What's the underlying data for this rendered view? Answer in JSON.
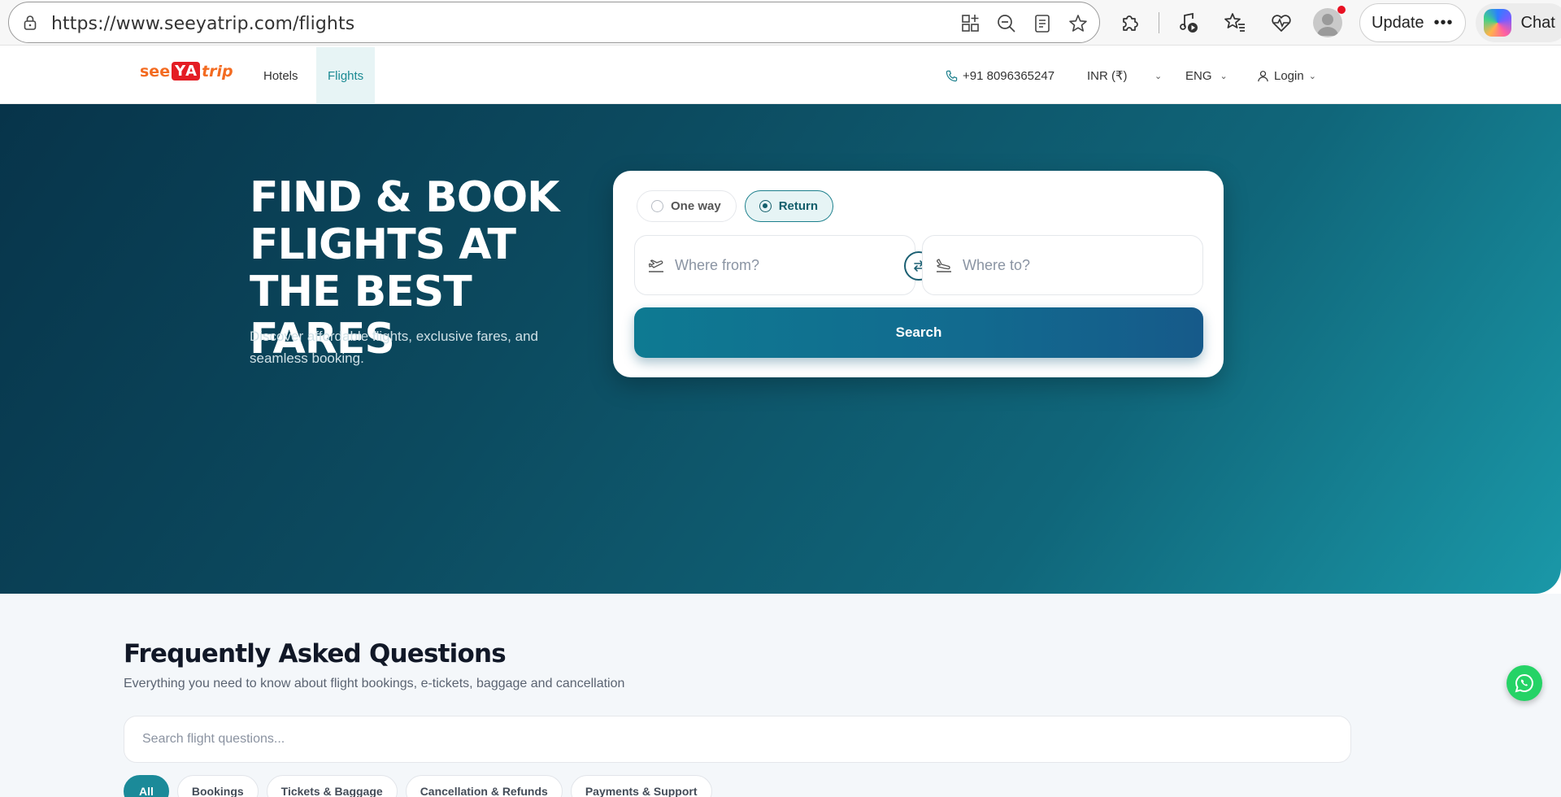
{
  "browser": {
    "url": "https://www.seeyatrip.com/flights",
    "update_label": "Update",
    "update_more": "•••",
    "chat_label": "Chat"
  },
  "header": {
    "logo": {
      "see": "see",
      "ya": "YА",
      "trip": "trip"
    },
    "nav": [
      {
        "label": "Hotels"
      },
      {
        "label": "Flights",
        "active": true
      }
    ],
    "phone": "+91 8096365247",
    "currency": "INR (₹)",
    "language": "ENG",
    "login": "Login"
  },
  "hero": {
    "title": "FIND & BOOK FLIGHTS AT THE BEST FARES",
    "subtitle": "Discover affordable flights, exclusive fares, and seamless booking."
  },
  "search": {
    "trip_types": [
      {
        "label": "One way",
        "selected": false
      },
      {
        "label": "Return",
        "selected": true
      }
    ],
    "from_placeholder": "Where from?",
    "to_placeholder": "Where to?",
    "button": "Search"
  },
  "faq": {
    "title": "Frequently Asked Questions",
    "subtitle": "Everything you need to know about flight bookings, e-tickets, baggage and cancellation",
    "search_placeholder": "Search flight questions...",
    "tabs": [
      {
        "label": "All",
        "active": true
      },
      {
        "label": "Bookings"
      },
      {
        "label": "Tickets & Baggage"
      },
      {
        "label": "Cancellation & Refunds"
      },
      {
        "label": "Payments & Support"
      }
    ]
  },
  "colors": {
    "brand_orange": "#f36b21",
    "brand_red": "#e41d24",
    "accent_teal": "#1b8a99",
    "hero_dark": "#07344a",
    "hero_light": "#1a98a8",
    "whatsapp_green": "#25d366"
  },
  "icons": [
    "lock-icon",
    "apps-icon",
    "zoom-out-icon",
    "reader-icon",
    "favorite-star-icon",
    "extensions-icon",
    "media-icon",
    "favorites-icon",
    "health-icon",
    "profile-avatar",
    "copilot-icon",
    "phone-icon",
    "user-icon",
    "takeoff-icon",
    "landing-icon",
    "swap-icon",
    "whatsapp-icon"
  ]
}
